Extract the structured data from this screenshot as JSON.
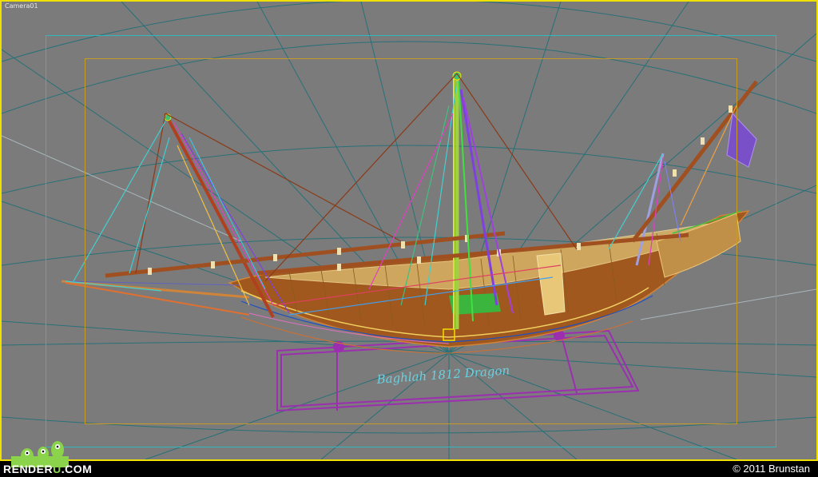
{
  "viewport": {
    "label": "Camera01",
    "background": "#7b7b7b",
    "border_color": "#f0e000",
    "safe_frame_color": "#2fb8c0",
    "action_frame_color": "#c89a28"
  },
  "scene": {
    "model": "ship-wireframe",
    "stand_plaque_text": "Baghlah 1812 Dragon"
  },
  "footer": {
    "logo_prefix": "RENDER",
    "logo_accent": "U",
    "logo_suffix": ".COM",
    "logo_mascot": "green-blob-mascot",
    "copyright": "© 2011 Brunstan"
  }
}
